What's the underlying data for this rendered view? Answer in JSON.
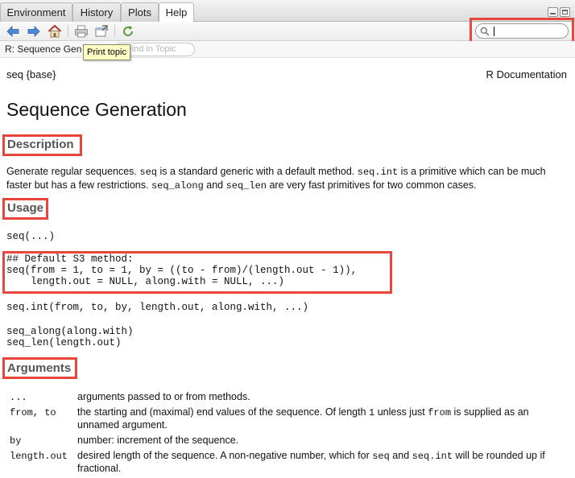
{
  "tabs": [
    {
      "label": "Environment"
    },
    {
      "label": "History"
    },
    {
      "label": "Plots"
    },
    {
      "label": "Help"
    }
  ],
  "toolbar": {
    "icons": [
      "back-arrow-icon",
      "forward-arrow-icon",
      "home-icon",
      "print-icon",
      "open-in-new-window-icon",
      "refresh-icon"
    ],
    "search_value": ""
  },
  "topic": {
    "title": "R: Sequence Generation",
    "find_placeholder": "Find in Topic",
    "tooltip": "Print topic"
  },
  "doc": {
    "package": "seq {base}",
    "doc_label": "R Documentation",
    "title": "Sequence Generation",
    "description_heading": "Description",
    "description": [
      {
        "t": "Generate regular sequences. "
      },
      {
        "c": "seq"
      },
      {
        "t": " is a standard generic with a default method. "
      },
      {
        "c": "seq.int"
      },
      {
        "t": " is a primitive which can be much faster but has a few restrictions. "
      },
      {
        "c": "seq_along"
      },
      {
        "t": " and "
      },
      {
        "c": "seq_len"
      },
      {
        "t": " are very fast primitives for two common cases."
      }
    ],
    "usage_heading": "Usage",
    "usage": [
      "seq(...)",
      "## Default S3 method:\nseq(from = 1, to = 1, by = ((to - from)/(length.out - 1)),\n    length.out = NULL, along.with = NULL, ...)",
      "seq.int(from, to, by, length.out, along.with, ...)",
      "seq_along(along.with)\nseq_len(length.out)"
    ],
    "arguments_heading": "Arguments",
    "arguments": [
      {
        "name": "...",
        "desc": [
          {
            "t": "arguments passed to or from methods."
          }
        ]
      },
      {
        "name": "from, to",
        "desc": [
          {
            "t": "the starting and (maximal) end values of the sequence. Of length "
          },
          {
            "c": "1"
          },
          {
            "t": " unless just "
          },
          {
            "c": "from"
          },
          {
            "t": " is supplied as an unnamed argument."
          }
        ]
      },
      {
        "name": "by",
        "desc": [
          {
            "t": "number: increment of the sequence."
          }
        ]
      },
      {
        "name": "length.out",
        "desc": [
          {
            "t": "desired length of the sequence. A non-negative number, which for "
          },
          {
            "c": "seq"
          },
          {
            "t": " and "
          },
          {
            "c": "seq.int"
          },
          {
            "t": " will be rounded up if fractional."
          }
        ]
      }
    ]
  },
  "highlight_color": "#e8453c"
}
